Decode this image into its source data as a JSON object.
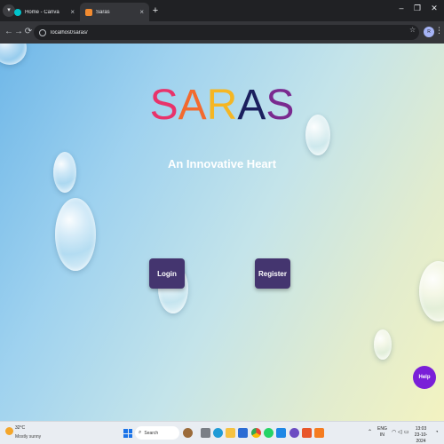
{
  "browser": {
    "tabs": [
      {
        "label": "Home - Canva",
        "favicon_color": "#00c4cc",
        "active": false
      },
      {
        "label": "Saras",
        "favicon_color": "#f28b30",
        "active": true
      }
    ],
    "new_tab_symbol": "+",
    "close_symbol": "×",
    "window_controls": {
      "minimize": "–",
      "maximize": "❐",
      "close": "✕"
    },
    "address": "localhost/saras/",
    "profile_initial": "R"
  },
  "page": {
    "brand_letters": [
      {
        "char": "S",
        "color": "#e8336b"
      },
      {
        "char": "A",
        "color": "#f26a2e"
      },
      {
        "char": "R",
        "color": "#f5b623"
      },
      {
        "char": "A",
        "color": "#1b1f5e"
      },
      {
        "char": "S",
        "color": "#7a2a8f"
      }
    ],
    "subtitle": "An Innovative Heart",
    "login_label": "Login",
    "register_label": "Register",
    "help_label": "Help",
    "accent": "#44356f"
  },
  "taskbar": {
    "weather_temp": "32°C",
    "weather_desc": "Mostly sunny",
    "search_label": "Search",
    "lang_line1": "ENG",
    "lang_line2": "IN",
    "time": "13:03",
    "date": "23-10-2024",
    "pinned_icons": [
      "explorer-icon",
      "edge-icon",
      "store-icon",
      "chrome-icon",
      "vscode-icon",
      "mail-icon",
      "whatsapp-icon",
      "settings-icon",
      "git-icon",
      "xampp-icon",
      "app-icon"
    ]
  }
}
